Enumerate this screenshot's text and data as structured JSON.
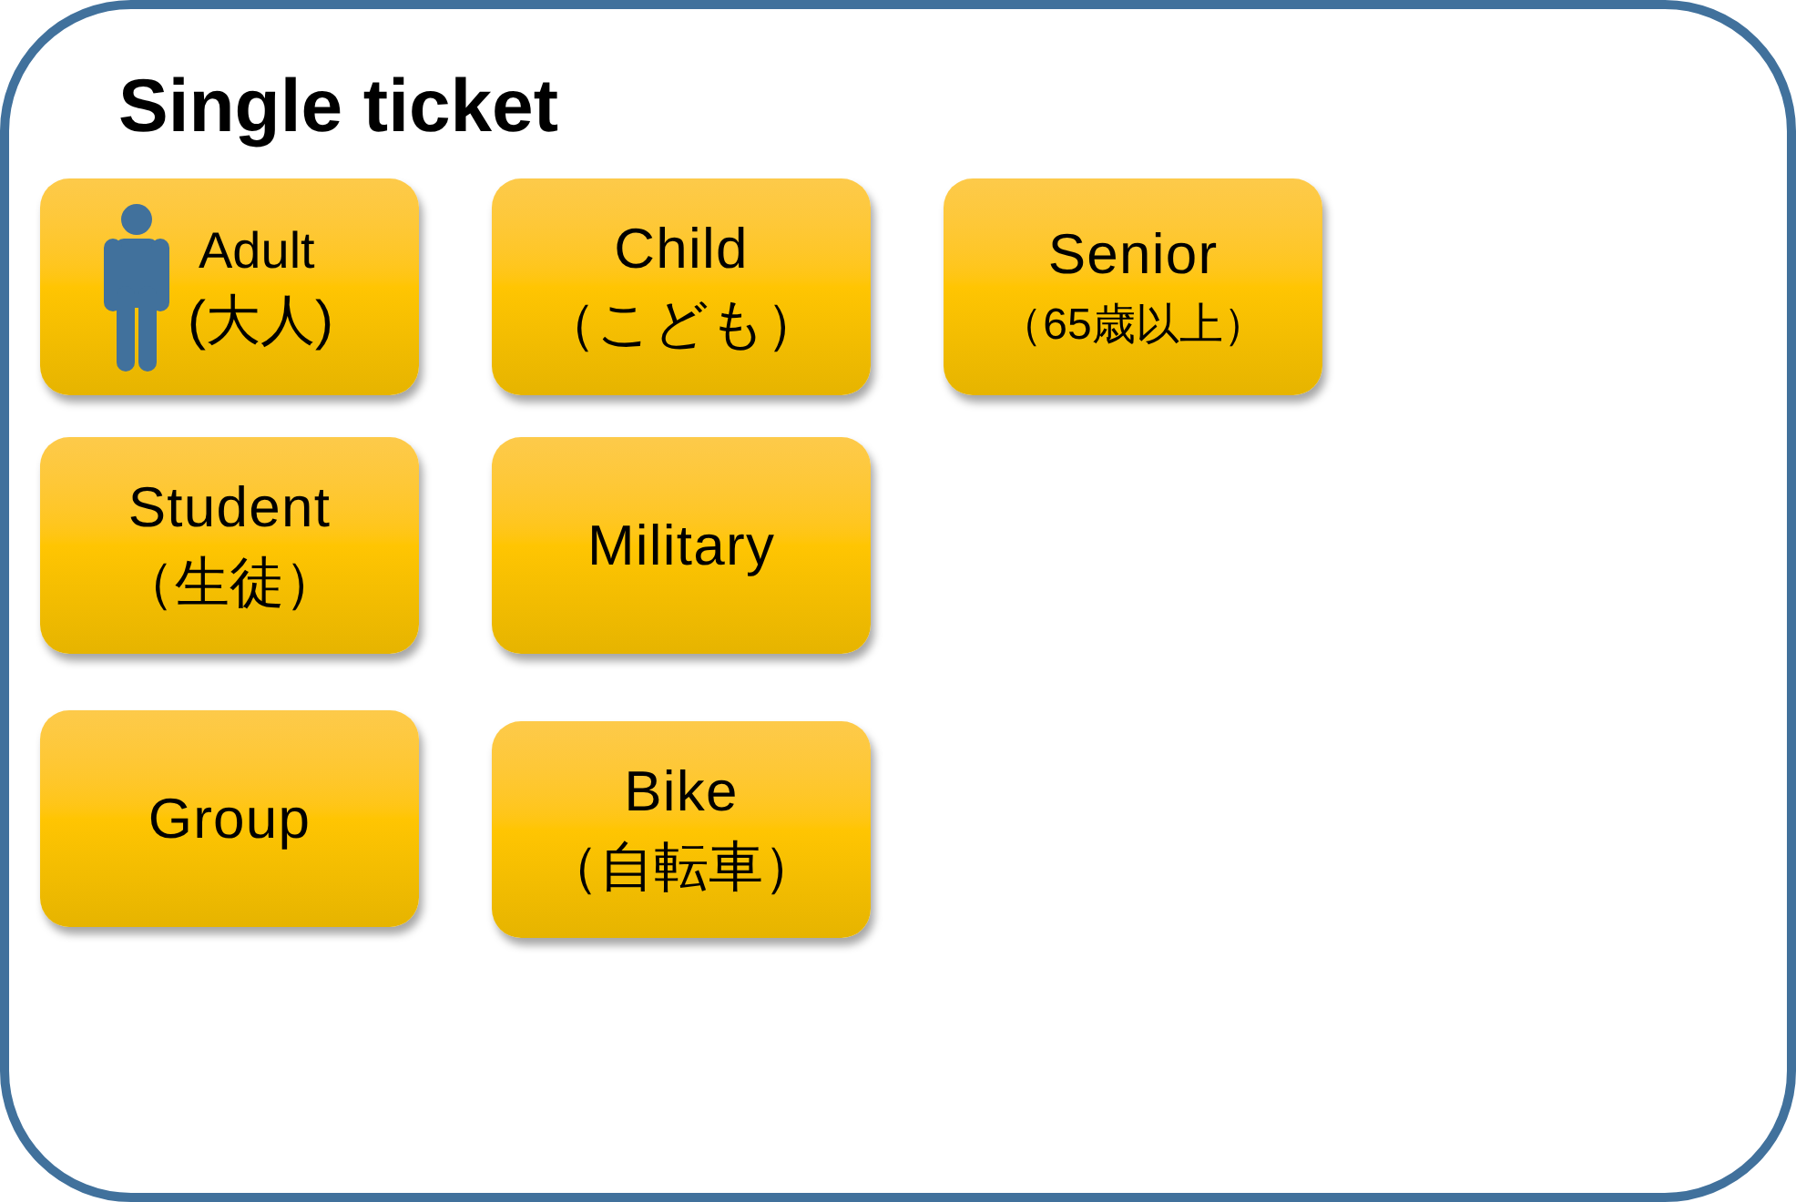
{
  "title": "Single ticket",
  "ticket_rows": [
    {
      "tickets": [
        {
          "kind": "icon",
          "label": "Adult",
          "sublabel": "(大人)"
        },
        {
          "kind": "plain",
          "label": "Child",
          "sublabel": "（こども）"
        },
        {
          "kind": "note",
          "label": "Senior",
          "sublabel": "（65歳以上）"
        }
      ]
    },
    {
      "tickets": [
        {
          "kind": "plain",
          "label": "Student",
          "sublabel": "（生徒）"
        },
        {
          "kind": "plain",
          "label": "Military"
        }
      ]
    },
    {
      "tickets": [
        {
          "kind": "plain",
          "label": "Group"
        },
        {
          "kind": "plain",
          "label": "Bike",
          "sublabel": "（自転車）"
        }
      ]
    }
  ]
}
